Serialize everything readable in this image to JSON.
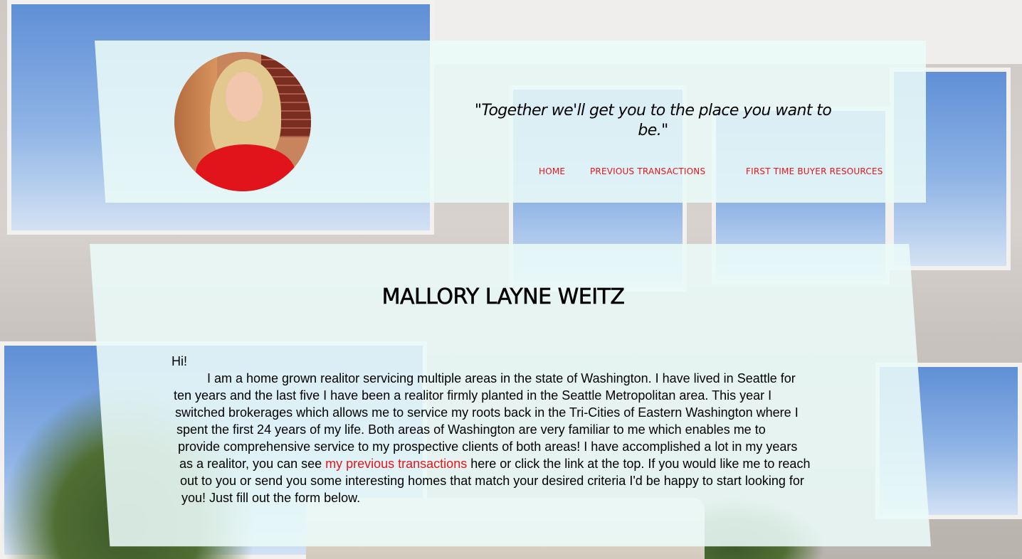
{
  "header": {
    "tagline": "\"Together we'll get you to the place you want to be.\"",
    "nav": [
      {
        "label": "Home"
      },
      {
        "label": "Previous Transactions"
      },
      {
        "label": "First Time Buyer Resources"
      }
    ]
  },
  "main": {
    "name": "MALLORY LAYNE WEITZ",
    "greeting": "Hi!",
    "bio": {
      "line1": "I am a home grown realitor servicing multiple areas in the state of Washington. I have lived in Seattle for",
      "line2": "ten years and the last five I have been a realitor firmly planted in the Seattle Metropolitan area. This year I",
      "line3": "switched brokerages which allows me to service my roots back in the Tri-Cities of Eastern Washington where I",
      "line4": "spent the first 24 years of my life. Both areas of Washington are very familiar to me which enables me to",
      "line5": "provide comprehensive service to my prospective clients of both areas! I have accomplished a lot in my years",
      "line6_before": "as a realitor, you can see ",
      "line6_link": "my previous transactions",
      "line6_after": " here or click the link at the top. If you would like me to reach",
      "line7": "out to you or send you some interesting homes that match your desired criteria I'd be happy to start looking for",
      "line8": "you! Just fill out the form below."
    }
  },
  "colors": {
    "accent": "#e3161c",
    "panel": "#ebfaf8"
  }
}
